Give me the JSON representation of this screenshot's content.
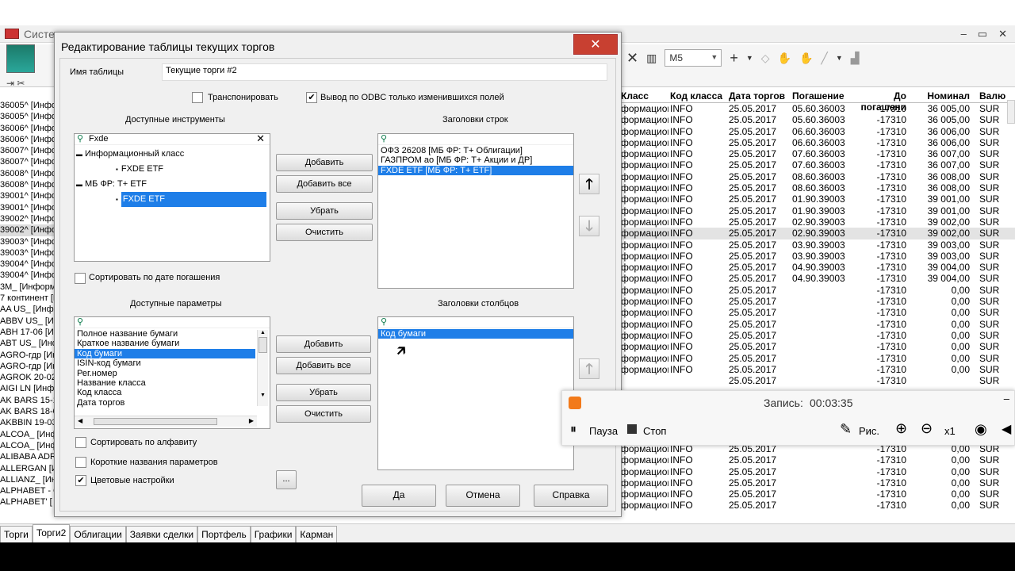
{
  "app": {
    "title": "Систе",
    "toolbar": {
      "timeframe": "M5",
      "close": "✕",
      "plus": "+"
    },
    "left_tree": [
      "36005^ [Инфо",
      "36005^ [Инфо",
      "36006^ [Инфо",
      "36006^ [Инфо",
      "36007^ [Инфо",
      "36007^ [Инфо",
      "36008^ [Инфо",
      "36008^ [Инфо",
      "39001^ [Инфо",
      "39001^ [Инфо",
      "39002^ [Инфо",
      "39002^ [Инфо",
      "39003^ [Инфо",
      "39003^ [Инфо",
      "39004^ [Инфо",
      "39004^ [Инфо",
      "3M_ [Информ",
      "7 континент [И",
      "AA US_ [Инф",
      "ABBV US_ [Ин",
      "ABH 17-06 [Ин",
      "ABT US_ [Инф",
      "AGRO-гдр [Ин",
      "AGRO-гдр [Ин",
      "AGROK 20-02",
      "AIGI LN [Инф",
      "AK BARS 15-1",
      "AK BARS 18-0",
      "AKBBIN 19-03",
      "ALCOA_ [Инф",
      "ALCOA_ [Инф",
      "ALIBABA ADR",
      "ALLERGAN [Ин",
      "ALLIANZ_ [Ин",
      "ALPHABET - C",
      "ALPHABET' ["
    ],
    "left_selected_index": 11,
    "grid": {
      "headers": [
        "Класс",
        "Код класса",
        "Дата торгов",
        "Погашение",
        "До погашени",
        "Номинал",
        "Валю"
      ],
      "rows": [
        [
          "формационны",
          "INFO",
          "25.05.2017",
          "05.60.36003",
          "-17310",
          "36 005,00",
          "SUR"
        ],
        [
          "формационны",
          "INFO",
          "25.05.2017",
          "05.60.36003",
          "-17310",
          "36 005,00",
          "SUR"
        ],
        [
          "формационны",
          "INFO",
          "25.05.2017",
          "06.60.36003",
          "-17310",
          "36 006,00",
          "SUR"
        ],
        [
          "формационны",
          "INFO",
          "25.05.2017",
          "06.60.36003",
          "-17310",
          "36 006,00",
          "SUR"
        ],
        [
          "формационны",
          "INFO",
          "25.05.2017",
          "07.60.36003",
          "-17310",
          "36 007,00",
          "SUR"
        ],
        [
          "формационны",
          "INFO",
          "25.05.2017",
          "07.60.36003",
          "-17310",
          "36 007,00",
          "SUR"
        ],
        [
          "формационны",
          "INFO",
          "25.05.2017",
          "08.60.36003",
          "-17310",
          "36 008,00",
          "SUR"
        ],
        [
          "формационны",
          "INFO",
          "25.05.2017",
          "08.60.36003",
          "-17310",
          "36 008,00",
          "SUR"
        ],
        [
          "формационны",
          "INFO",
          "25.05.2017",
          "01.90.39003",
          "-17310",
          "39 001,00",
          "SUR"
        ],
        [
          "формационны",
          "INFO",
          "25.05.2017",
          "01.90.39003",
          "-17310",
          "39 001,00",
          "SUR"
        ],
        [
          "формационны",
          "INFO",
          "25.05.2017",
          "02.90.39003",
          "-17310",
          "39 002,00",
          "SUR"
        ],
        [
          "формационны",
          "INFO",
          "25.05.2017",
          "02.90.39003",
          "-17310",
          "39 002,00",
          "SUR"
        ],
        [
          "формационны",
          "INFO",
          "25.05.2017",
          "03.90.39003",
          "-17310",
          "39 003,00",
          "SUR"
        ],
        [
          "формационны",
          "INFO",
          "25.05.2017",
          "03.90.39003",
          "-17310",
          "39 003,00",
          "SUR"
        ],
        [
          "формационны",
          "INFO",
          "25.05.2017",
          "04.90.39003",
          "-17310",
          "39 004,00",
          "SUR"
        ],
        [
          "формационны",
          "INFO",
          "25.05.2017",
          "04.90.39003",
          "-17310",
          "39 004,00",
          "SUR"
        ],
        [
          "формационны",
          "INFO",
          "25.05.2017",
          "",
          "-17310",
          "0,00",
          "SUR"
        ],
        [
          "формационны",
          "INFO",
          "25.05.2017",
          "",
          "-17310",
          "0,00",
          "SUR"
        ],
        [
          "формационны",
          "INFO",
          "25.05.2017",
          "",
          "-17310",
          "0,00",
          "SUR"
        ],
        [
          "формационны",
          "INFO",
          "25.05.2017",
          "",
          "-17310",
          "0,00",
          "SUR"
        ],
        [
          "формационны",
          "INFO",
          "25.05.2017",
          "",
          "-17310",
          "0,00",
          "SUR"
        ],
        [
          "формационны",
          "INFO",
          "25.05.2017",
          "",
          "-17310",
          "0,00",
          "SUR"
        ],
        [
          "формационны",
          "INFO",
          "25.05.2017",
          "",
          "-17310",
          "0,00",
          "SUR"
        ],
        [
          "формационны",
          "INFO",
          "25.05.2017",
          "",
          "-17310",
          "0,00",
          "SUR"
        ],
        [
          "",
          "",
          "25.05.2017",
          "",
          "-17310",
          "",
          "SUR"
        ],
        [
          "",
          "",
          "",
          "",
          "",
          "",
          ""
        ],
        [
          "",
          "",
          "",
          "",
          "",
          "",
          ""
        ],
        [
          "",
          "",
          "",
          "",
          "",
          "",
          ""
        ],
        [
          "",
          "",
          "",
          "",
          "",
          "",
          ""
        ],
        [
          "",
          "",
          "",
          "",
          "",
          "",
          ""
        ],
        [
          "формационны",
          "INFO",
          "25.05.2017",
          "",
          "-17310",
          "0,00",
          "SUR"
        ],
        [
          "формационны",
          "INFO",
          "25.05.2017",
          "",
          "-17310",
          "0,00",
          "SUR"
        ],
        [
          "формационны",
          "INFO",
          "25.05.2017",
          "",
          "-17310",
          "0,00",
          "SUR"
        ],
        [
          "формационны",
          "INFO",
          "25.05.2017",
          "",
          "-17310",
          "0,00",
          "SUR"
        ],
        [
          "формационны",
          "INFO",
          "25.05.2017",
          "",
          "-17310",
          "0,00",
          "SUR"
        ],
        [
          "формационны",
          "INFO",
          "25.05.2017",
          "",
          "-17310",
          "0,00",
          "SUR"
        ]
      ]
    },
    "tabs": [
      "Торги",
      "Торги2",
      "Облигации",
      "Заявки сделки",
      "Портфель",
      "Графики",
      "Карман"
    ],
    "active_tab": "Торги2"
  },
  "dialog": {
    "title": "Редактирование таблицы текущих торгов",
    "table_name_label": "Имя таблицы",
    "table_name_value": "Текущие торги #2",
    "transpose_label": "Транспонировать",
    "transpose_checked": false,
    "odbc_label": "Вывод по ODBC только изменившихся  полей",
    "odbc_checked": true,
    "available_instruments_label": "Доступные инструменты",
    "instruments_search": "Fxde",
    "instruments_tree": [
      {
        "text": "Информационный класс",
        "level": 0
      },
      {
        "text": "FXDE ETF",
        "level": 1
      },
      {
        "text": "МБ ФР: Т+ ЕТF",
        "level": 0
      },
      {
        "text": "FXDE ETF",
        "level": 1,
        "selected": true
      }
    ],
    "row_headers_label": "Заголовки строк",
    "row_headers": [
      {
        "text": "ОФЗ 26208 [МБ ФР: Т+ Облигации]"
      },
      {
        "text": "ГАЗПРОМ ао [МБ ФР: Т+ Акции и ДР]"
      },
      {
        "text": "FXDE ETF [МБ ФР: Т+ ETF]",
        "selected": true
      }
    ],
    "sort_by_maturity_label": "Сортировать по дате погашения",
    "available_params_label": "Доступные параметры",
    "params": [
      {
        "text": "Полное название бумаги"
      },
      {
        "text": "Краткое название бумаги"
      },
      {
        "text": "Код бумаги",
        "selected": true
      },
      {
        "text": "ISIN-код бумаги"
      },
      {
        "text": "Рег.номер"
      },
      {
        "text": "Название класса"
      },
      {
        "text": "Код класса"
      },
      {
        "text": "Дата торгов"
      }
    ],
    "column_headers_label": "Заголовки столбцов",
    "column_headers": [
      {
        "text": "Код бумаги",
        "selected": true
      }
    ],
    "add": "Добавить",
    "add_all": "Добавить все",
    "remove": "Убрать",
    "clear": "Очистить",
    "sort_alpha_label": "Сортировать по алфавиту",
    "short_names_label": "Короткие названия параметров",
    "color_settings_label": "Цветовые настройки",
    "color_settings_checked": true,
    "ellipsis": "...",
    "ok": "Да",
    "cancel": "Отмена",
    "help": "Справка",
    "close": "✕"
  },
  "recorder": {
    "record_label": "Запись:",
    "time": "00:03:35",
    "pause": "Пауза",
    "stop": "Стоп",
    "draw": "Рис.",
    "zoom": "x1"
  }
}
